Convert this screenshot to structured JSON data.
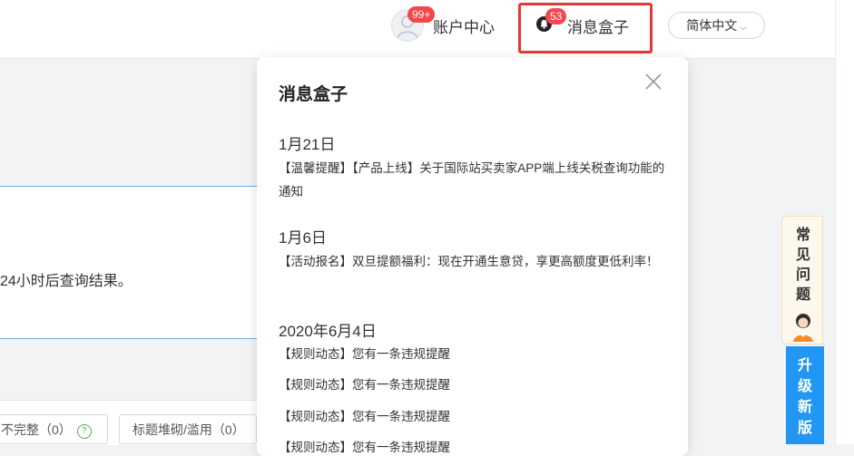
{
  "header": {
    "account_badge": "99+",
    "account_label": "账户中心",
    "inbox_badge": "53",
    "inbox_label": "消息盒子",
    "language": "简体中文",
    "avatar_icon": "user-avatar-icon",
    "bell_icon": "bell-icon"
  },
  "background": {
    "content_text": "24小时后查询结果。",
    "filter_chip_1": "不完整（0）",
    "filter_chip_2": "标题堆砌/滥用（0）"
  },
  "inbox_panel": {
    "title": "消息盒子",
    "close_icon": "close-icon",
    "groups": [
      {
        "date": "1月21日",
        "messages": [
          "【温馨提醒】【产品上线】关于国际站买卖家APP端上线关税查询功能的通知"
        ]
      },
      {
        "date": "1月6日",
        "messages": [
          "【活动报名】双旦提额福利：现在开通生意贷，享更高额度更低利率！"
        ]
      },
      {
        "date": "2020年6月4日",
        "messages": [
          "【规则动态】您有一条违规提醒",
          "【规则动态】您有一条违规提醒",
          "【规则动态】您有一条违规提醒",
          "【规则动态】您有一条违规提醒"
        ]
      }
    ]
  },
  "side_widget": {
    "help_label": "常见问题",
    "upgrade_label": "升级新版"
  },
  "colors": {
    "badge": "#f5464b",
    "highlight_border": "#e53935",
    "upgrade": "#2196f3"
  }
}
